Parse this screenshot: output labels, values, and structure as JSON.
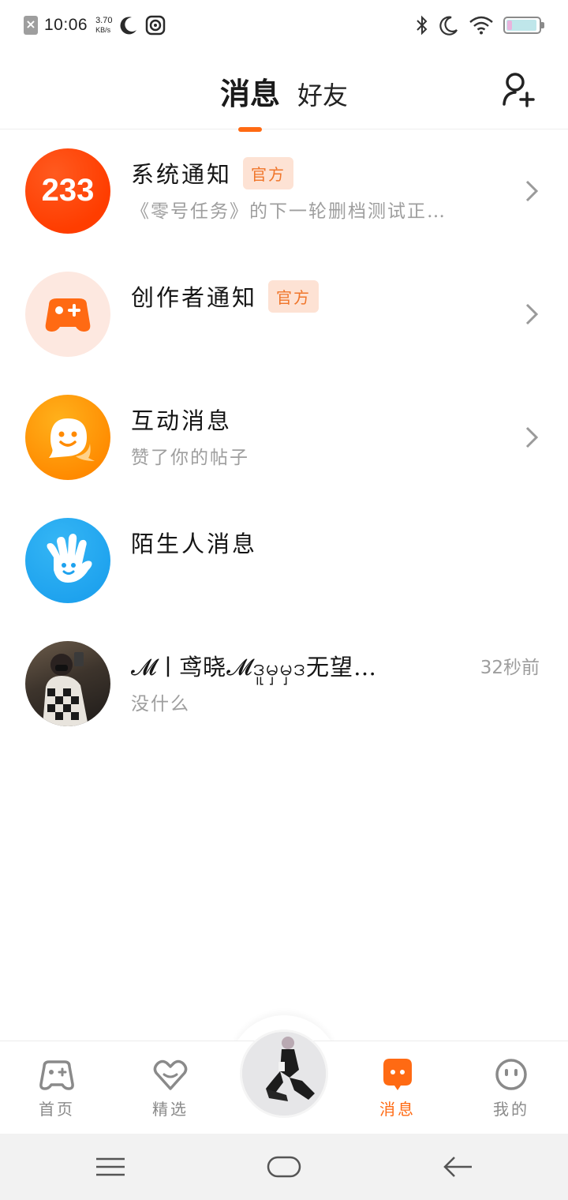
{
  "status_bar": {
    "time": "10:06",
    "speed_value": "3.70",
    "speed_unit": "KB/s",
    "battery_level": 0.95
  },
  "header": {
    "tabs": [
      {
        "label": "消息",
        "active": true
      },
      {
        "label": "好友",
        "active": false
      }
    ],
    "add_friend_icon": "add-user-icon"
  },
  "messages": [
    {
      "title": "系统通知",
      "badge": "官方",
      "subtitle": "《零号任务》的下一轮删档测试正…",
      "avatar_text": "233",
      "icon": "233-logo-icon",
      "has_chevron": true
    },
    {
      "title": "创作者通知",
      "badge": "官方",
      "subtitle": "",
      "icon": "gamepad-icon",
      "has_chevron": true
    },
    {
      "title": "互动消息",
      "badge": "",
      "subtitle": "赞了你的帖子",
      "icon": "chat-smile-icon",
      "has_chevron": true
    },
    {
      "title": "陌生人消息",
      "badge": "",
      "subtitle": "",
      "icon": "hand-wave-icon",
      "has_chevron": false
    },
    {
      "title": "𝓜ㅣ鸢晓𝓜ဒူမှမှဒ无望…",
      "badge": "",
      "subtitle": "没什么",
      "time": "32秒前",
      "icon": "user-photo-avatar",
      "has_chevron": false
    }
  ],
  "bottom_nav": [
    {
      "label": "首页",
      "icon": "gamepad-icon",
      "active": false
    },
    {
      "label": "精选",
      "icon": "heart-diamond-icon",
      "active": false
    },
    {
      "label": "消息",
      "icon": "message-bubble-icon",
      "active": true
    },
    {
      "label": "我的",
      "icon": "smiley-face-icon",
      "active": false
    }
  ],
  "colors": {
    "accent": "#ff6a13",
    "badge_bg": "#fde2d4",
    "badge_text": "#f0752a",
    "subtitle": "#9e9e9e"
  }
}
